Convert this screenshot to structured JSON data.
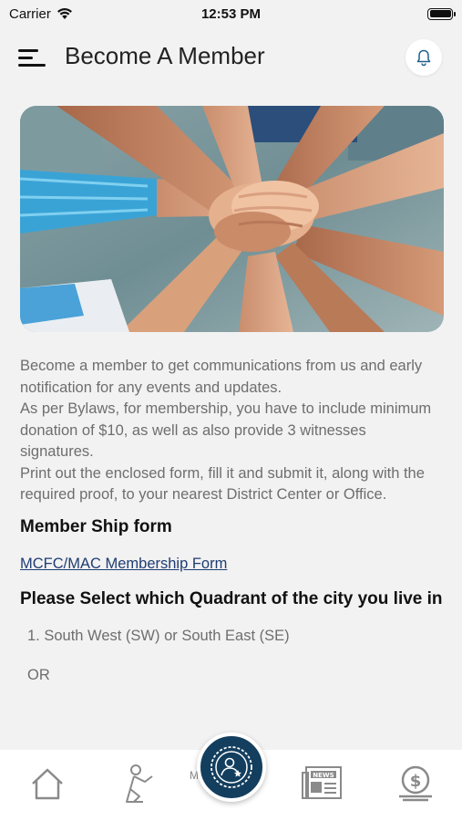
{
  "status": {
    "carrier": "Carrier",
    "time": "12:53 PM"
  },
  "header": {
    "title": "Become A Member"
  },
  "intro": {
    "p1": "Become a member to get communications from us and early notification for any events and updates.",
    "p2": "As per Bylaws, for membership, you have to include minimum donation of $10, as well as also provide 3 witnesses signatures.",
    "p3": "Print out the enclosed form, fill it and submit it, along with the required proof, to your nearest District Center or Office."
  },
  "form_section": {
    "heading": "Member Ship form",
    "link": "MCFC/MAC Membership Form"
  },
  "quadrant": {
    "heading": "Please Select which Quadrant of the city you live in",
    "option1": "1. South West (SW) or South East (SE)",
    "or": "OR"
  },
  "tabs": {
    "icons": [
      "home-icon",
      "pray-icon",
      "member-badge-icon",
      "news-icon",
      "donate-icon"
    ],
    "center_partial_label": "M"
  },
  "colors": {
    "accent": "#133e5e",
    "link": "#1f3d73",
    "text_muted": "#6e6e6e",
    "background": "#f2f2f2"
  }
}
